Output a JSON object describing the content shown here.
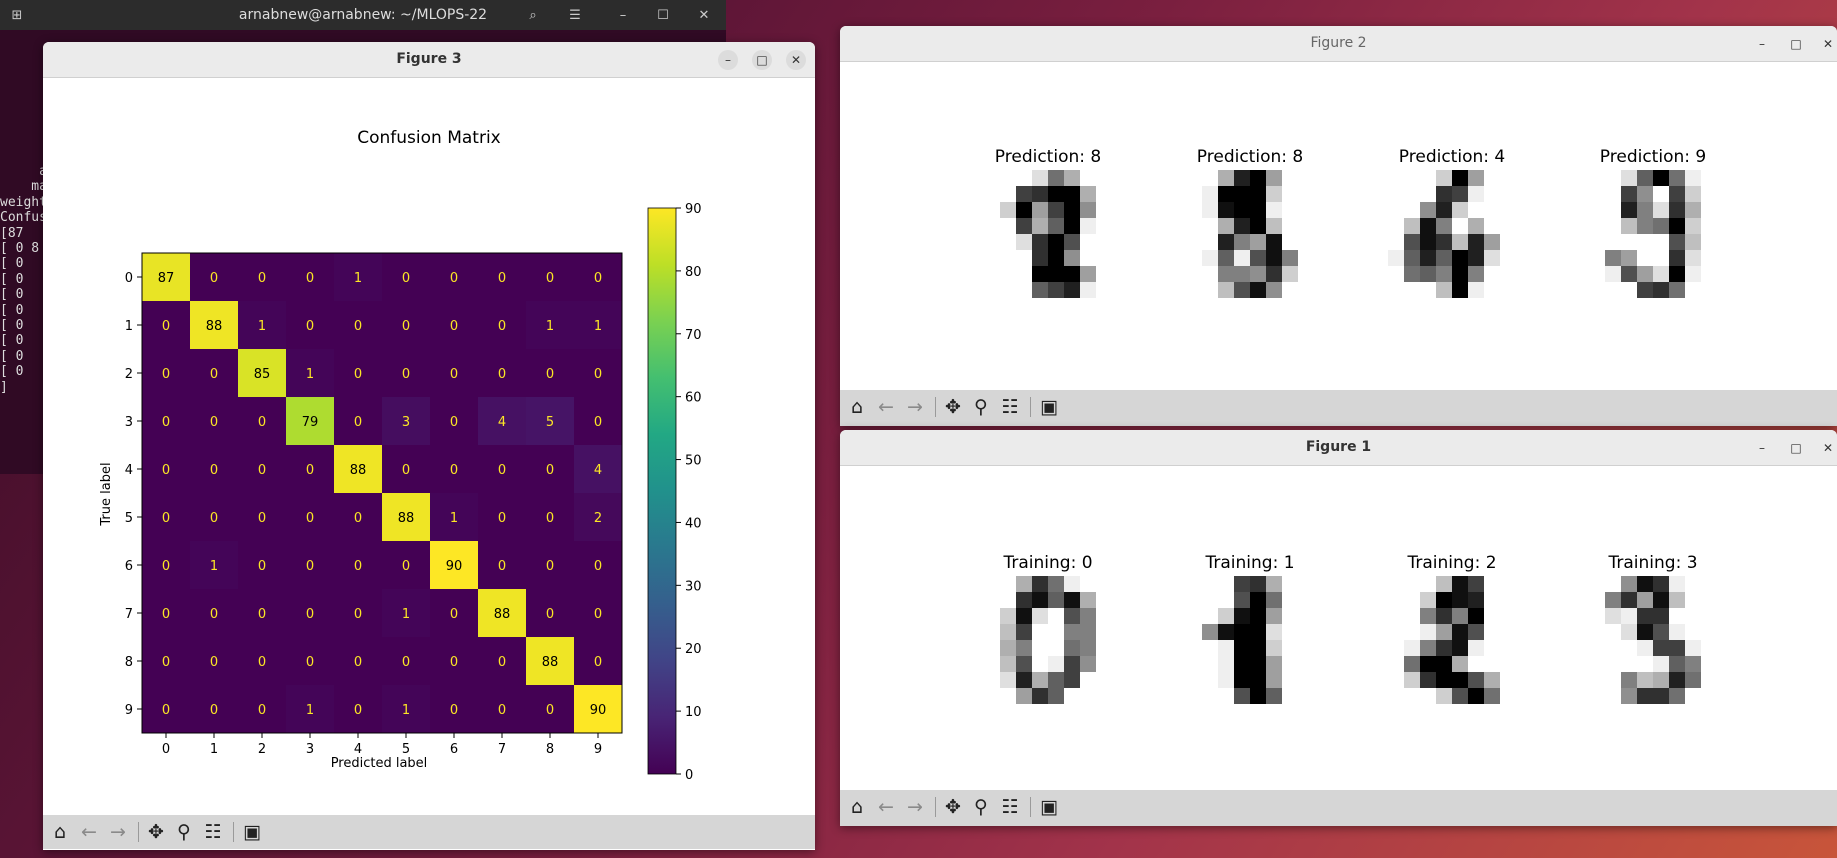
{
  "terminal": {
    "title": "arnabnew@arnabnew: ~/MLOPS-22",
    "lines": [
      "     ac",
      "    mac",
      "weight",
      "",
      "Confus",
      "[87",
      "[ 0 8",
      "[ 0",
      "[ 0",
      "[ 0",
      "[ 0",
      "[ 0",
      "[ 0",
      "[ 0",
      "[ 0",
      "]"
    ]
  },
  "figure3": {
    "title": "Figure 3",
    "chart_data": {
      "type": "heatmap",
      "title": "Confusion Matrix",
      "xlabel": "Predicted label",
      "ylabel": "True label",
      "x_ticks": [
        "0",
        "1",
        "2",
        "3",
        "4",
        "5",
        "6",
        "7",
        "8",
        "9"
      ],
      "y_ticks": [
        "0",
        "1",
        "2",
        "3",
        "4",
        "5",
        "6",
        "7",
        "8",
        "9"
      ],
      "matrix": [
        [
          87,
          0,
          0,
          0,
          1,
          0,
          0,
          0,
          0,
          0
        ],
        [
          0,
          88,
          1,
          0,
          0,
          0,
          0,
          0,
          1,
          1
        ],
        [
          0,
          0,
          85,
          1,
          0,
          0,
          0,
          0,
          0,
          0
        ],
        [
          0,
          0,
          0,
          79,
          0,
          3,
          0,
          4,
          5,
          0
        ],
        [
          0,
          0,
          0,
          0,
          88,
          0,
          0,
          0,
          0,
          4
        ],
        [
          0,
          0,
          0,
          0,
          0,
          88,
          1,
          0,
          0,
          2
        ],
        [
          0,
          1,
          0,
          0,
          0,
          0,
          90,
          0,
          0,
          0
        ],
        [
          0,
          0,
          0,
          0,
          0,
          1,
          0,
          88,
          0,
          0
        ],
        [
          0,
          0,
          0,
          0,
          0,
          0,
          0,
          0,
          88,
          0
        ],
        [
          0,
          0,
          0,
          1,
          0,
          1,
          0,
          0,
          0,
          90
        ]
      ],
      "colorbar": {
        "ticks": [
          "0",
          "10",
          "20",
          "30",
          "40",
          "50",
          "60",
          "70",
          "80",
          "90"
        ],
        "vmin": 0,
        "vmax": 90,
        "colormap": "viridis"
      }
    }
  },
  "figure2": {
    "title": "Figure 2",
    "panels": [
      {
        "title": "Prediction: 8",
        "pixels": [
          [
            0,
            0,
            0,
            2,
            9,
            5,
            0,
            0
          ],
          [
            0,
            0,
            12,
            13,
            16,
            16,
            5,
            0
          ],
          [
            0,
            3,
            16,
            6,
            12,
            16,
            7,
            0
          ],
          [
            0,
            0,
            12,
            5,
            10,
            16,
            1,
            0
          ],
          [
            0,
            0,
            2,
            13,
            16,
            11,
            0,
            0
          ],
          [
            0,
            0,
            0,
            13,
            16,
            7,
            0,
            0
          ],
          [
            0,
            0,
            0,
            16,
            16,
            16,
            6,
            0
          ],
          [
            0,
            0,
            0,
            10,
            12,
            14,
            1,
            0
          ]
        ]
      },
      {
        "title": "Prediction: 8",
        "pixels": [
          [
            0,
            0,
            5,
            14,
            16,
            6,
            0,
            0
          ],
          [
            0,
            1,
            16,
            16,
            16,
            3,
            0,
            0
          ],
          [
            0,
            1,
            15,
            16,
            16,
            1,
            0,
            0
          ],
          [
            0,
            0,
            5,
            14,
            16,
            4,
            0,
            0
          ],
          [
            0,
            0,
            14,
            8,
            6,
            15,
            0,
            0
          ],
          [
            0,
            1,
            10,
            1,
            11,
            15,
            8,
            0
          ],
          [
            0,
            0,
            8,
            8,
            7,
            13,
            3,
            0
          ],
          [
            0,
            0,
            4,
            11,
            15,
            7,
            0,
            0
          ]
        ]
      },
      {
        "title": "Prediction: 4",
        "pixels": [
          [
            0,
            0,
            0,
            3,
            16,
            6,
            0,
            0
          ],
          [
            0,
            0,
            0,
            13,
            12,
            1,
            0,
            0
          ],
          [
            0,
            0,
            7,
            14,
            3,
            0,
            0,
            0
          ],
          [
            0,
            4,
            15,
            8,
            0,
            5,
            0,
            0
          ],
          [
            0,
            11,
            15,
            13,
            4,
            14,
            6,
            0
          ],
          [
            1,
            10,
            14,
            10,
            16,
            14,
            2,
            0
          ],
          [
            0,
            9,
            10,
            8,
            16,
            8,
            0,
            0
          ],
          [
            0,
            0,
            0,
            4,
            16,
            1,
            0,
            0
          ]
        ]
      },
      {
        "title": "Prediction: 9",
        "pixels": [
          [
            0,
            0,
            2,
            10,
            16,
            9,
            1,
            0
          ],
          [
            0,
            0,
            12,
            7,
            0,
            12,
            3,
            0
          ],
          [
            0,
            0,
            14,
            8,
            2,
            13,
            5,
            0
          ],
          [
            0,
            0,
            4,
            8,
            9,
            16,
            3,
            0
          ],
          [
            0,
            0,
            0,
            0,
            0,
            11,
            4,
            0
          ],
          [
            0,
            8,
            6,
            0,
            0,
            13,
            2,
            0
          ],
          [
            0,
            1,
            11,
            6,
            2,
            16,
            1,
            0
          ],
          [
            0,
            0,
            0,
            12,
            13,
            9,
            0,
            0
          ]
        ]
      }
    ]
  },
  "figure1": {
    "title": "Figure 1",
    "panels": [
      {
        "title": "Training: 0",
        "pixels": [
          [
            0,
            0,
            5,
            13,
            9,
            1,
            0,
            0
          ],
          [
            0,
            0,
            13,
            15,
            10,
            15,
            5,
            0
          ],
          [
            0,
            3,
            15,
            2,
            0,
            11,
            8,
            0
          ],
          [
            0,
            4,
            12,
            0,
            0,
            8,
            8,
            0
          ],
          [
            0,
            5,
            8,
            0,
            0,
            9,
            8,
            0
          ],
          [
            0,
            4,
            11,
            0,
            1,
            12,
            7,
            0
          ],
          [
            0,
            2,
            14,
            5,
            10,
            12,
            0,
            0
          ],
          [
            0,
            0,
            6,
            13,
            10,
            0,
            0,
            0
          ]
        ]
      },
      {
        "title": "Training: 1",
        "pixels": [
          [
            0,
            0,
            0,
            12,
            13,
            5,
            0,
            0
          ],
          [
            0,
            0,
            0,
            11,
            16,
            9,
            0,
            0
          ],
          [
            0,
            0,
            3,
            15,
            16,
            6,
            0,
            0
          ],
          [
            0,
            7,
            15,
            16,
            16,
            2,
            0,
            0
          ],
          [
            0,
            0,
            1,
            16,
            16,
            3,
            0,
            0
          ],
          [
            0,
            0,
            1,
            16,
            16,
            6,
            0,
            0
          ],
          [
            0,
            0,
            1,
            16,
            16,
            6,
            0,
            0
          ],
          [
            0,
            0,
            0,
            11,
            16,
            10,
            0,
            0
          ]
        ]
      },
      {
        "title": "Training: 2",
        "pixels": [
          [
            0,
            0,
            0,
            4,
            15,
            12,
            0,
            0
          ],
          [
            0,
            0,
            3,
            16,
            15,
            14,
            0,
            0
          ],
          [
            0,
            0,
            8,
            13,
            8,
            16,
            0,
            0
          ],
          [
            0,
            0,
            1,
            6,
            15,
            11,
            0,
            0
          ],
          [
            0,
            1,
            8,
            13,
            15,
            1,
            0,
            0
          ],
          [
            0,
            9,
            16,
            16,
            5,
            0,
            0,
            0
          ],
          [
            0,
            3,
            13,
            16,
            16,
            11,
            5,
            0
          ],
          [
            0,
            0,
            0,
            3,
            11,
            16,
            9,
            0
          ]
        ]
      },
      {
        "title": "Training: 3",
        "pixels": [
          [
            0,
            0,
            7,
            15,
            13,
            1,
            0,
            0
          ],
          [
            0,
            8,
            13,
            6,
            15,
            4,
            0,
            0
          ],
          [
            0,
            2,
            1,
            13,
            13,
            0,
            0,
            0
          ],
          [
            0,
            0,
            2,
            15,
            11,
            1,
            0,
            0
          ],
          [
            0,
            0,
            0,
            1,
            12,
            12,
            1,
            0
          ],
          [
            0,
            0,
            0,
            0,
            1,
            10,
            8,
            0
          ],
          [
            0,
            0,
            8,
            4,
            5,
            14,
            9,
            0
          ],
          [
            0,
            0,
            7,
            13,
            13,
            9,
            0,
            0
          ]
        ]
      }
    ]
  },
  "toolbar_icons": [
    "home-icon",
    "back-icon",
    "forward-icon",
    "pan-icon",
    "zoom-icon",
    "configure-subplots-icon",
    "save-icon"
  ]
}
